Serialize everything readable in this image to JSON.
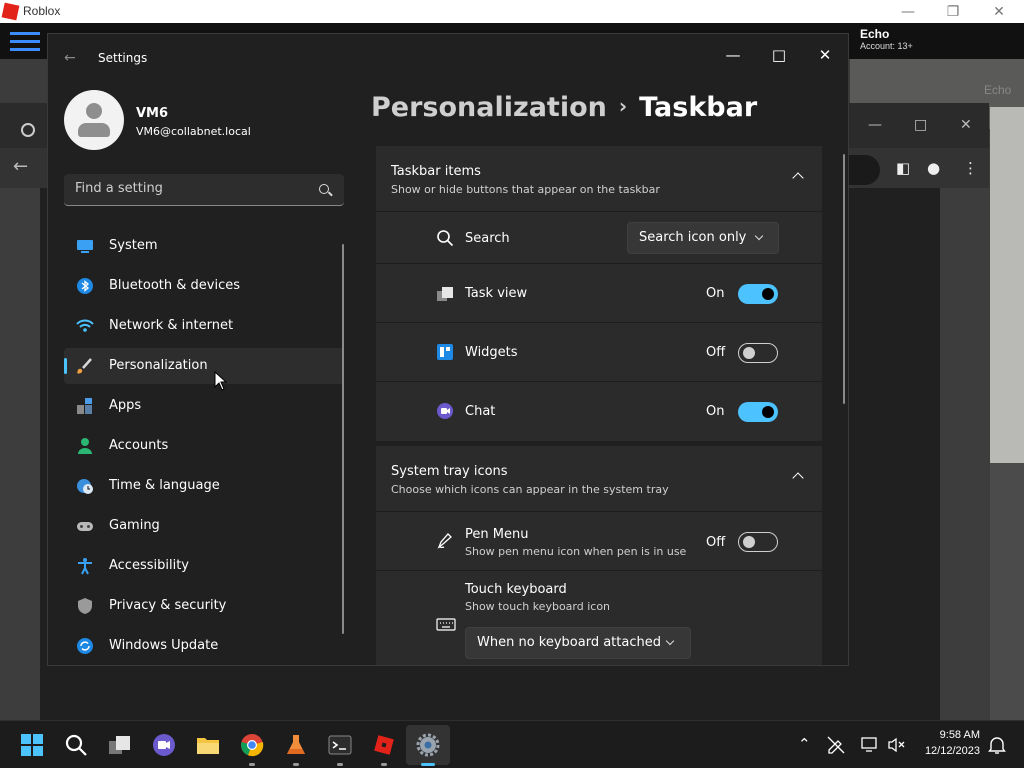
{
  "host_window": {
    "title": "Roblox"
  },
  "game": {
    "user_name": "Echo",
    "account": "Account: 13+",
    "nametag": "Echo"
  },
  "settings": {
    "window_title": "Settings",
    "user": {
      "name": "VM6",
      "email": "VM6@collabnet.local"
    },
    "search_placeholder": "Find a setting",
    "nav": [
      {
        "label": "System",
        "icon": "monitor-icon"
      },
      {
        "label": "Bluetooth & devices",
        "icon": "bluetooth-icon"
      },
      {
        "label": "Network & internet",
        "icon": "wifi-icon"
      },
      {
        "label": "Personalization",
        "icon": "paintbrush-icon",
        "active": true
      },
      {
        "label": "Apps",
        "icon": "apps-icon"
      },
      {
        "label": "Accounts",
        "icon": "person-icon"
      },
      {
        "label": "Time & language",
        "icon": "globe-clock-icon"
      },
      {
        "label": "Gaming",
        "icon": "gamepad-icon"
      },
      {
        "label": "Accessibility",
        "icon": "accessibility-icon"
      },
      {
        "label": "Privacy & security",
        "icon": "shield-icon"
      },
      {
        "label": "Windows Update",
        "icon": "update-icon"
      }
    ],
    "breadcrumb": {
      "parent": "Personalization",
      "current": "Taskbar"
    },
    "taskbar_items": {
      "title": "Taskbar items",
      "subtitle": "Show or hide buttons that appear on the taskbar",
      "search": {
        "label": "Search",
        "value": "Search icon only"
      },
      "task_view": {
        "label": "Task view",
        "state": "On"
      },
      "widgets": {
        "label": "Widgets",
        "state": "Off"
      },
      "chat": {
        "label": "Chat",
        "state": "On"
      }
    },
    "system_tray": {
      "title": "System tray icons",
      "subtitle": "Choose which icons can appear in the system tray",
      "pen_menu": {
        "label": "Pen Menu",
        "sub": "Show pen menu icon when pen is in use",
        "state": "Off"
      },
      "touch_keyboard": {
        "label": "Touch keyboard",
        "sub": "Show touch keyboard icon",
        "value": "When no keyboard attached"
      }
    }
  },
  "taskbar": {
    "time": "9:58 AM",
    "date": "12/12/2023"
  },
  "colors": {
    "accent": "#4cc2ff",
    "panel": "#2b2b2b",
    "window": "#202020"
  }
}
